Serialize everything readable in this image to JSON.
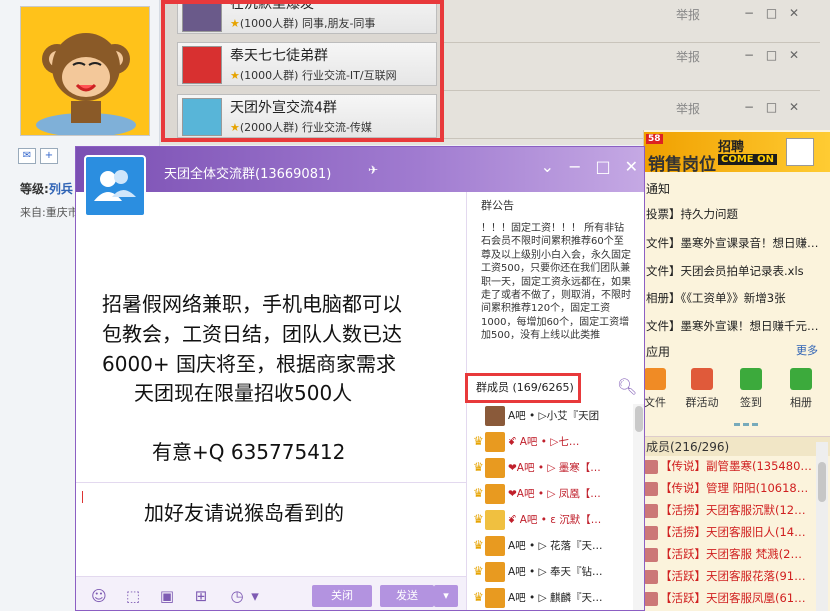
{
  "forum": {
    "contact_icons": [
      "✉",
      "+"
    ],
    "level_label": "等级:",
    "level_value": "列兵",
    "from_label": "来自:重庆市",
    "report_label": "举报"
  },
  "groups": [
    {
      "name": "在沉默里爆发",
      "stars": "★",
      "meta": "(1000人群) 同事,朋友-同事",
      "icon_color": "#6a5a8a"
    },
    {
      "name": "奉天七七徒弟群",
      "stars": "★",
      "meta": "(1000人群) 行业交流-IT/互联网",
      "icon_color": "#d83030"
    },
    {
      "name": "天团外宣交流4群",
      "stars": "★",
      "meta": "(2000人群) 行业交流-传媒",
      "icon_color": "#58b5d8"
    }
  ],
  "chat": {
    "title": "天团全体交流群(13669081)",
    "controls": [
      "⌄",
      "−",
      "□",
      "✕"
    ],
    "message_lines": [
      "招暑假网络兼职，手机电脑都可以",
      "包教会，工资日结，团队人数已达",
      "6000+ 国庆将至，根据商家需求",
      "天团现在限量招收500人",
      "有意+Q 635775412"
    ],
    "input_text": "加好友请说猴岛看到的",
    "close_button": "关闭",
    "send_button": "发送",
    "send_dropdown": "▾"
  },
  "notice": {
    "title": "群公告",
    "body": "！！！固定工资！！！ 所有非钻石会员不限时间累积推荐60个至尊及以上级别小白入会，永久固定工资500，只要你还在我们团队兼职一天，固定工资永远都在，如果走了或者不做了，则取消，不限时间累积推荐120个，固定工资1000，每增加60个，固定工资增加500，没有上线以此类推"
  },
  "members": {
    "tab_label": "群成员 (169/6265)",
    "list": [
      {
        "rank": "",
        "nick": "A吧 • ▷小艾『天团",
        "color": "#8a5a3a"
      },
      {
        "rank": "♛",
        "nick": "ꗄ A吧 • ▷七…",
        "color": "#e89a20"
      },
      {
        "rank": "♛",
        "nick": "❤A吧 • ▷ 墨寒【…",
        "color": "#e89a20"
      },
      {
        "rank": "♛",
        "nick": "❤A吧 • ▷ 凤凰【…",
        "color": "#e89a20"
      },
      {
        "rank": "♛",
        "nick": "ꗄ A吧 • ε 沉默【…",
        "color": "#f0c040"
      },
      {
        "rank": "♛",
        "nick": "A吧 • ▷ 花落『天…",
        "color": "#e89a20"
      },
      {
        "rank": "♛",
        "nick": "A吧 • ▷ 奉天『钻…",
        "color": "#e89a20"
      },
      {
        "rank": "♛",
        "nick": "A吧 • ▷ 麒麟『天…",
        "color": "#e89a20"
      }
    ]
  },
  "right_panel": {
    "promo_corner": "58",
    "promo_title": "销售岗位",
    "promo_sub1": "招聘",
    "promo_sub2": "COME ON",
    "notice_header": "通知",
    "notices": [
      {
        "tag": "",
        "text": "投票】持久力问题"
      },
      {
        "tag": "",
        "text": "文件】墨寒外宣课录音！想日赚…"
      },
      {
        "tag": "",
        "text": "文件】天团会员拍单记录表.xls"
      },
      {
        "tag": "",
        "text": "相册】《《工资单》》新增3张"
      },
      {
        "tag": "",
        "text": "文件】墨寒外宣课！想日赚千元…"
      }
    ],
    "apps_header": "应用",
    "more_link": "更多",
    "apps": [
      {
        "label": "文件",
        "color": "#f08b25"
      },
      {
        "label": "群活动",
        "color": "#e05a3a"
      },
      {
        "label": "签到",
        "color": "#3caa3c"
      },
      {
        "label": "相册",
        "color": "#3caa3c"
      }
    ],
    "members_header": "成员(216/296)",
    "member_rows": [
      {
        "tag": "【传说】",
        "name": "副管墨寒(135480…"
      },
      {
        "tag": "【传说】",
        "name": "管理 阳阳(10618…"
      },
      {
        "tag": "【活捞】",
        "name": "天团客服沉默(12…"
      },
      {
        "tag": "【活捞】",
        "name": "天团客服旧人(14…"
      },
      {
        "tag": "【活跃】",
        "name": "天团客服 梵溅(2…"
      },
      {
        "tag": "【活跃】",
        "name": "天团客服花落(91…"
      },
      {
        "tag": "【活跃】",
        "name": "天团客服凤凰(61…"
      }
    ]
  }
}
